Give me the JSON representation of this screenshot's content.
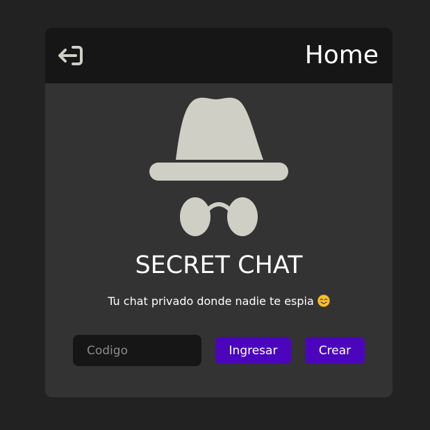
{
  "header": {
    "title": "Home",
    "logout_icon": "logout-icon"
  },
  "hero": {
    "icon": "incognito-icon",
    "app_name": "SECRET CHAT",
    "tagline": "Tu chat privado donde nadie te espia",
    "tagline_emoji": "smiling-face-emoji"
  },
  "form": {
    "code_placeholder": "Codigo",
    "code_value": "",
    "enter_label": "Ingresar",
    "create_label": "Crear"
  },
  "colors": {
    "background": "#222222",
    "card": "#333333",
    "header": "#161616",
    "accent": "#4b06bd",
    "icon": "#d0cfc5"
  }
}
